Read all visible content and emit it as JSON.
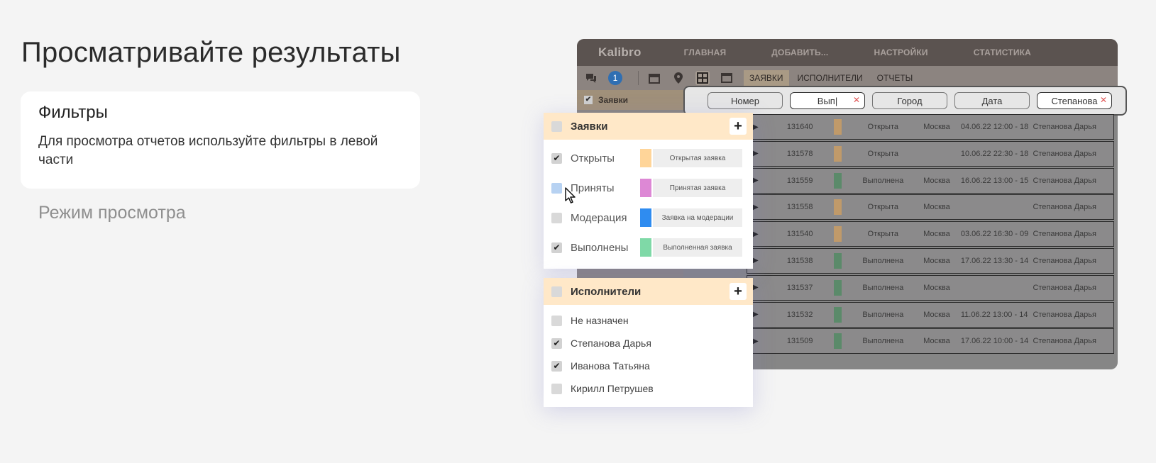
{
  "page": {
    "title": "Просматривайте результаты",
    "card": {
      "title": "Фильтры",
      "text": "Для просмотра отчетов используйте фильтры в левой части"
    },
    "mode_link": "Режим просмотра"
  },
  "app": {
    "logo": "Kalibro",
    "nav": [
      "ГЛАВНАЯ",
      "ДОБАВИТЬ...",
      "НАСТРОЙКИ",
      "СТАТИСТИКА"
    ],
    "badge": "1",
    "tabs": [
      "ЗАЯВКИ",
      "ИСПОЛНИТЕЛИ",
      "ОТЧЕТЫ"
    ],
    "left_head": "Заявки",
    "filters": [
      {
        "label": "Номер",
        "filled": false
      },
      {
        "label": "Вып|",
        "filled": true
      },
      {
        "label": "Город",
        "filled": false
      },
      {
        "label": "Дата",
        "filled": false
      },
      {
        "label": "Степанова",
        "filled": true
      }
    ],
    "rows": [
      {
        "num": "131640",
        "color": "#c09a6a",
        "status": "Открыта",
        "city": "Москва",
        "date": "04.06.22 12:00 - 18",
        "person": "Степанова Дарья"
      },
      {
        "num": "131578",
        "color": "#c09a6a",
        "status": "Открыта",
        "city": "",
        "date": "10.06.22 22:30 - 18",
        "person": "Степанова Дарья"
      },
      {
        "num": "131559",
        "color": "#5b8a6a",
        "status": "Выполнена",
        "city": "Москва",
        "date": "16.06.22 13:00 - 15",
        "person": "Степанова Дарья"
      },
      {
        "num": "131558",
        "color": "#c09a6a",
        "status": "Открыта",
        "city": "Москва",
        "date": "",
        "person": "Степанова Дарья"
      },
      {
        "num": "131540",
        "color": "#c09a6a",
        "status": "Открыта",
        "city": "Москва",
        "date": "03.06.22 16:30 - 09",
        "person": "Степанова Дарья"
      },
      {
        "num": "131538",
        "color": "#5b8a6a",
        "status": "Выполнена",
        "city": "Москва",
        "date": "17.06.22 13:30 - 14",
        "person": "Степанова Дарья"
      },
      {
        "num": "131537",
        "color": "#5b8a6a",
        "status": "Выполнена",
        "city": "Москва",
        "date": "",
        "person": "Степанова Дарья"
      },
      {
        "num": "131532",
        "color": "#5b8a6a",
        "status": "Выполнена",
        "city": "Москва",
        "date": "11.06.22 13:00 - 14",
        "person": "Степанова Дарья"
      },
      {
        "num": "131509",
        "color": "#5b8a6a",
        "status": "Выполнена",
        "city": "Москва",
        "date": "17.06.22 10:00 - 14",
        "person": "Степанова Дарья"
      }
    ]
  },
  "orders_panel": {
    "title": "Заявки",
    "items": [
      {
        "label": "Открыты",
        "checked": true,
        "color": "#ffd599",
        "tag": "Открытая заявка"
      },
      {
        "label": "Приняты",
        "checked": false,
        "color": "#dd88d5",
        "tag": "Принятая заявка"
      },
      {
        "label": "Модерация",
        "checked": false,
        "color": "#2f8cf0",
        "tag": "Заявка на модерации"
      },
      {
        "label": "Выполнены",
        "checked": true,
        "color": "#7fd9a7",
        "tag": "Выполненная заявка"
      }
    ]
  },
  "executors_panel": {
    "title": "Исполнители",
    "items": [
      {
        "label": "Не назначен",
        "checked": false
      },
      {
        "label": "Степанова Дарья",
        "checked": true
      },
      {
        "label": "Иванова Татьяна",
        "checked": true
      },
      {
        "label": "Кирилл Петрушев",
        "checked": false
      }
    ]
  }
}
